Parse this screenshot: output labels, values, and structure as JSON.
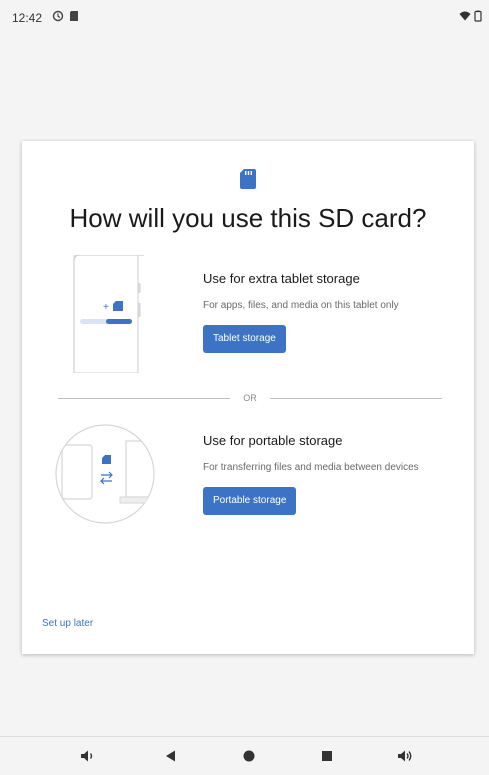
{
  "status_bar": {
    "time": "12:42",
    "left_icons": [
      "sync-icon",
      "sd-card-icon"
    ],
    "right_icons": [
      "wifi-icon",
      "battery-icon"
    ]
  },
  "dialog": {
    "title": "How will you use this SD card?",
    "options": [
      {
        "heading": "Use for extra tablet storage",
        "description": "For apps, files, and media on this tablet only",
        "button_label": "Tablet storage"
      },
      {
        "heading": "Use for portable storage",
        "description": "For transferring files and media between devices",
        "button_label": "Portable storage"
      }
    ],
    "divider_label": "OR",
    "setup_later_label": "Set up later"
  },
  "nav_bar": {
    "buttons": [
      "volume-down-icon",
      "back-icon",
      "home-icon",
      "recents-icon",
      "volume-up-icon"
    ]
  },
  "colors": {
    "accent": "#3c73c4",
    "background": "#f4f4f4",
    "card": "#ffffff"
  }
}
